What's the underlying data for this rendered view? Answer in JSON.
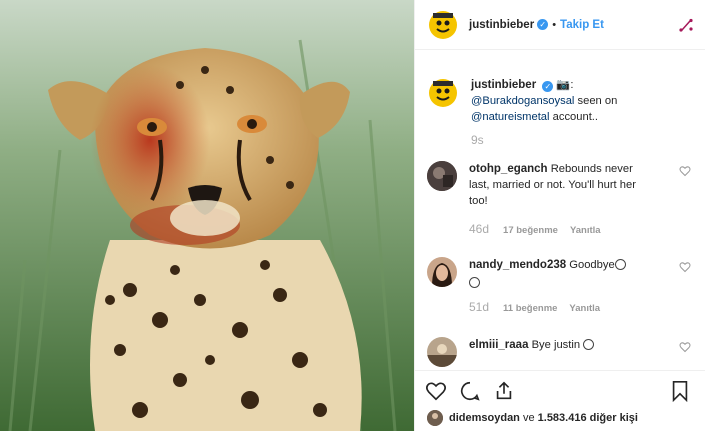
{
  "header": {
    "username": "justinbieber",
    "separator": "•",
    "follow_label": "Takip Et"
  },
  "caption": {
    "username": "justinbieber",
    "icon": "camera-emoji",
    "text_colon": ":",
    "mention1": "@Burakdogansoysal",
    "text_mid": " seen on ",
    "mention2": "@natureismetal",
    "text_end": " account..",
    "time": "9s"
  },
  "comments": [
    {
      "username": "otohp_eganch",
      "text": "Rebounds never last, married or not. You'll hurt her too!",
      "time": "46d",
      "likes": "17 beğenme",
      "reply": "Yanıtla"
    },
    {
      "username": "nandy_mendo238",
      "text": "Goodbye",
      "time": "51d",
      "likes": "11 beğenme",
      "reply": "Yanıtla"
    },
    {
      "username": "elmiii_raaa",
      "text": "Bye justin",
      "time": "",
      "likes": "",
      "reply": ""
    }
  ],
  "likes_line": {
    "user": "didemsoydan",
    "connector": " ve ",
    "count": "1.583.416 diğer kişi"
  },
  "colors": {
    "accent": "#3897f0",
    "mention": "#003569",
    "muted": "#999999"
  },
  "icons": [
    "heart-icon",
    "comment-icon",
    "share-icon",
    "bookmark-icon",
    "more-options-icon",
    "verified-badge-icon"
  ]
}
